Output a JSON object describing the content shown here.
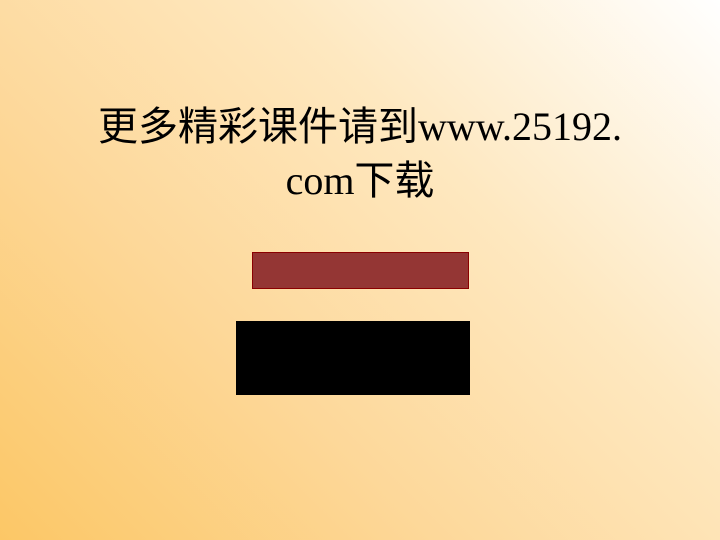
{
  "slide": {
    "title_line1": "更多精彩课件请到www.25192.",
    "title_line2": "com下载",
    "colors": {
      "red_box": "#943634",
      "black_box": "#000000",
      "background_light": "#ffffff",
      "background_dark": "#fcc766"
    }
  }
}
